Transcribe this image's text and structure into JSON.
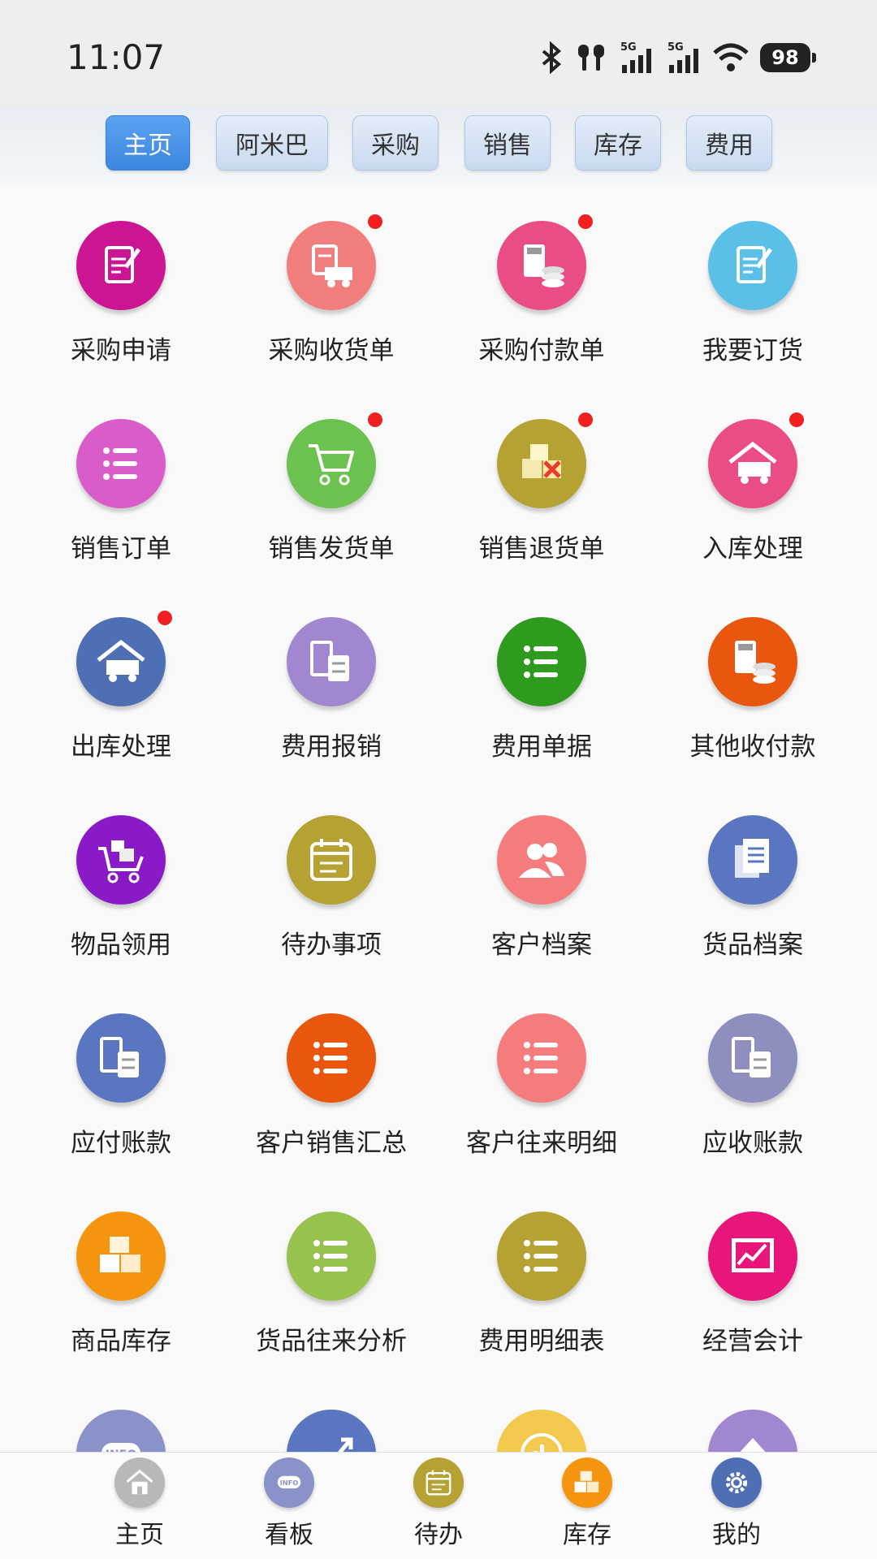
{
  "status": {
    "time": "11:07",
    "battery": "98",
    "network_1": "5G",
    "network_2": "5G"
  },
  "tabs": [
    {
      "label": "主页",
      "active": true
    },
    {
      "label": "阿米巴",
      "active": false
    },
    {
      "label": "采购",
      "active": false
    },
    {
      "label": "销售",
      "active": false
    },
    {
      "label": "库存",
      "active": false
    },
    {
      "label": "费用",
      "active": false
    }
  ],
  "items": [
    {
      "label": "采购申请",
      "icon": "edit-doc-icon",
      "color": "#cc1593",
      "badge": false
    },
    {
      "label": "采购收货单",
      "icon": "truck-doc-icon",
      "color": "#f27d7d",
      "badge": true
    },
    {
      "label": "采购付款单",
      "icon": "calculator-coins-icon",
      "color": "#ea4c86",
      "badge": true
    },
    {
      "label": "我要订货",
      "icon": "edit-doc-icon",
      "color": "#5bc0e8",
      "badge": false
    },
    {
      "label": "销售订单",
      "icon": "list-icon",
      "color": "#d95cc8",
      "badge": false
    },
    {
      "label": "销售发货单",
      "icon": "cart-icon",
      "color": "#6bc24e",
      "badge": true
    },
    {
      "label": "销售退货单",
      "icon": "boxes-x-icon",
      "color": "#b5a233",
      "badge": true
    },
    {
      "label": "入库处理",
      "icon": "warehouse-truck-icon",
      "color": "#ea4c86",
      "badge": true
    },
    {
      "label": "出库处理",
      "icon": "warehouse-truck-icon",
      "color": "#4f6fb5",
      "badge": true
    },
    {
      "label": "费用报销",
      "icon": "calculator-doc-icon",
      "color": "#a187d0",
      "badge": false
    },
    {
      "label": "费用单据",
      "icon": "list-icon",
      "color": "#2e9a1e",
      "badge": false
    },
    {
      "label": "其他收付款",
      "icon": "calculator-coins-icon",
      "color": "#e9560e",
      "badge": false
    },
    {
      "label": "物品领用",
      "icon": "cart-boxes-icon",
      "color": "#8a1ac7",
      "badge": false
    },
    {
      "label": "待办事项",
      "icon": "calendar-icon",
      "color": "#b5a233",
      "badge": false
    },
    {
      "label": "客户档案",
      "icon": "users-icon",
      "color": "#f47c7c",
      "badge": false
    },
    {
      "label": "货品档案",
      "icon": "documents-icon",
      "color": "#5b76c0",
      "badge": false
    },
    {
      "label": "应付账款",
      "icon": "calculator-doc-icon",
      "color": "#5b76c0",
      "badge": false
    },
    {
      "label": "客户销售汇总",
      "icon": "list-icon",
      "color": "#e9560e",
      "badge": false
    },
    {
      "label": "客户往来明细",
      "icon": "list-icon",
      "color": "#f47c7c",
      "badge": false
    },
    {
      "label": "应收账款",
      "icon": "calculator-doc-icon",
      "color": "#8f8fbf",
      "badge": false
    },
    {
      "label": "商品库存",
      "icon": "boxes-icon",
      "color": "#f5950f",
      "badge": false
    },
    {
      "label": "货品往来分析",
      "icon": "list-icon",
      "color": "#97c24e",
      "badge": false
    },
    {
      "label": "费用明细表",
      "icon": "list-icon",
      "color": "#b5a233",
      "badge": false
    },
    {
      "label": "经营会计",
      "icon": "chart-frame-icon",
      "color": "#e8157b",
      "badge": false
    },
    {
      "label": "",
      "icon": "info-icon",
      "color": "#8a93c9",
      "badge": false
    },
    {
      "label": "",
      "icon": "trend-icon",
      "color": "#5b76c0",
      "badge": false
    },
    {
      "label": "",
      "icon": "bar-chart-icon",
      "color": "#f2c94c",
      "badge": false
    },
    {
      "label": "",
      "icon": "arrow-up-icon",
      "color": "#a187d0",
      "badge": false
    }
  ],
  "bottom_nav": [
    {
      "label": "主页",
      "icon": "home-icon",
      "color": "#b8b8b8"
    },
    {
      "label": "看板",
      "icon": "info-icon",
      "color": "#8a93c9"
    },
    {
      "label": "待办",
      "icon": "calendar-icon",
      "color": "#b5a233"
    },
    {
      "label": "库存",
      "icon": "boxes-icon",
      "color": "#f5950f"
    },
    {
      "label": "我的",
      "icon": "gear-icon",
      "color": "#4f6fb5"
    }
  ]
}
